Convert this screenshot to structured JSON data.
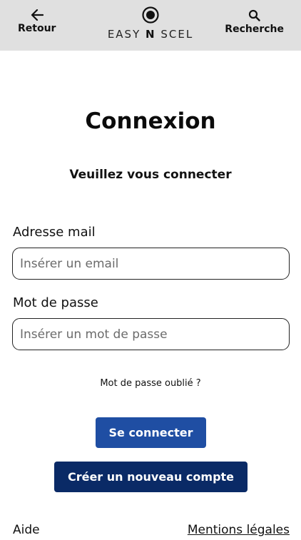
{
  "header": {
    "back_label": "Retour",
    "search_label": "Recherche",
    "brand": {
      "part1": "EASY ",
      "part2": "N",
      "part3": " SCEL"
    }
  },
  "main": {
    "title": "Connexion",
    "subtitle": "Veuillez vous connecter",
    "email": {
      "label": "Adresse mail",
      "placeholder": "Insérer un email",
      "value": ""
    },
    "password": {
      "label": "Mot de passe",
      "placeholder": "Insérer un mot de passe",
      "value": ""
    },
    "forgot_link": "Mot de passe oublié ?",
    "login_button": "Se connecter",
    "create_account_button": "Créer un nouveau compte"
  },
  "footer": {
    "help_link": "Aide",
    "legal_link": "Mentions légales"
  },
  "colors": {
    "header_bg": "#e0e0e0",
    "primary_button": "#1f4ea3",
    "secondary_button": "#0a2a66"
  },
  "icons": {
    "back": "arrow-left-icon",
    "search": "search-icon",
    "logo": "target-circle-icon"
  }
}
